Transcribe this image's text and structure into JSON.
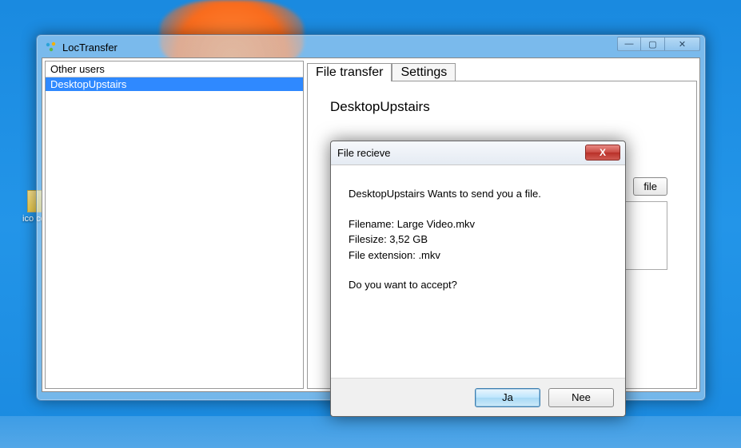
{
  "desktop": {
    "icon_label": "ico copy"
  },
  "window": {
    "title": "LocTransfer",
    "controls": {
      "min": "—",
      "max": "▢",
      "close": "✕"
    }
  },
  "sidebar": {
    "header": "Other users",
    "items": [
      {
        "label": "DesktopUpstairs",
        "selected": true
      }
    ]
  },
  "tabs": [
    {
      "label": "File transfer",
      "active": true
    },
    {
      "label": "Settings",
      "active": false
    }
  ],
  "transfer": {
    "peer_name": "DesktopUpstairs",
    "send_button": "file"
  },
  "dialog": {
    "title": "File recieve",
    "message": "DesktopUpstairs Wants to send you a file.",
    "filename_label": "Filename: ",
    "filename": "Large Video.mkv",
    "filesize_label": "Filesize: ",
    "filesize": "3,52 GB",
    "ext_label": "File extension: ",
    "ext": ".mkv",
    "accept_q": "Do you want to accept?",
    "yes": "Ja",
    "no": "Nee",
    "close": "X"
  }
}
